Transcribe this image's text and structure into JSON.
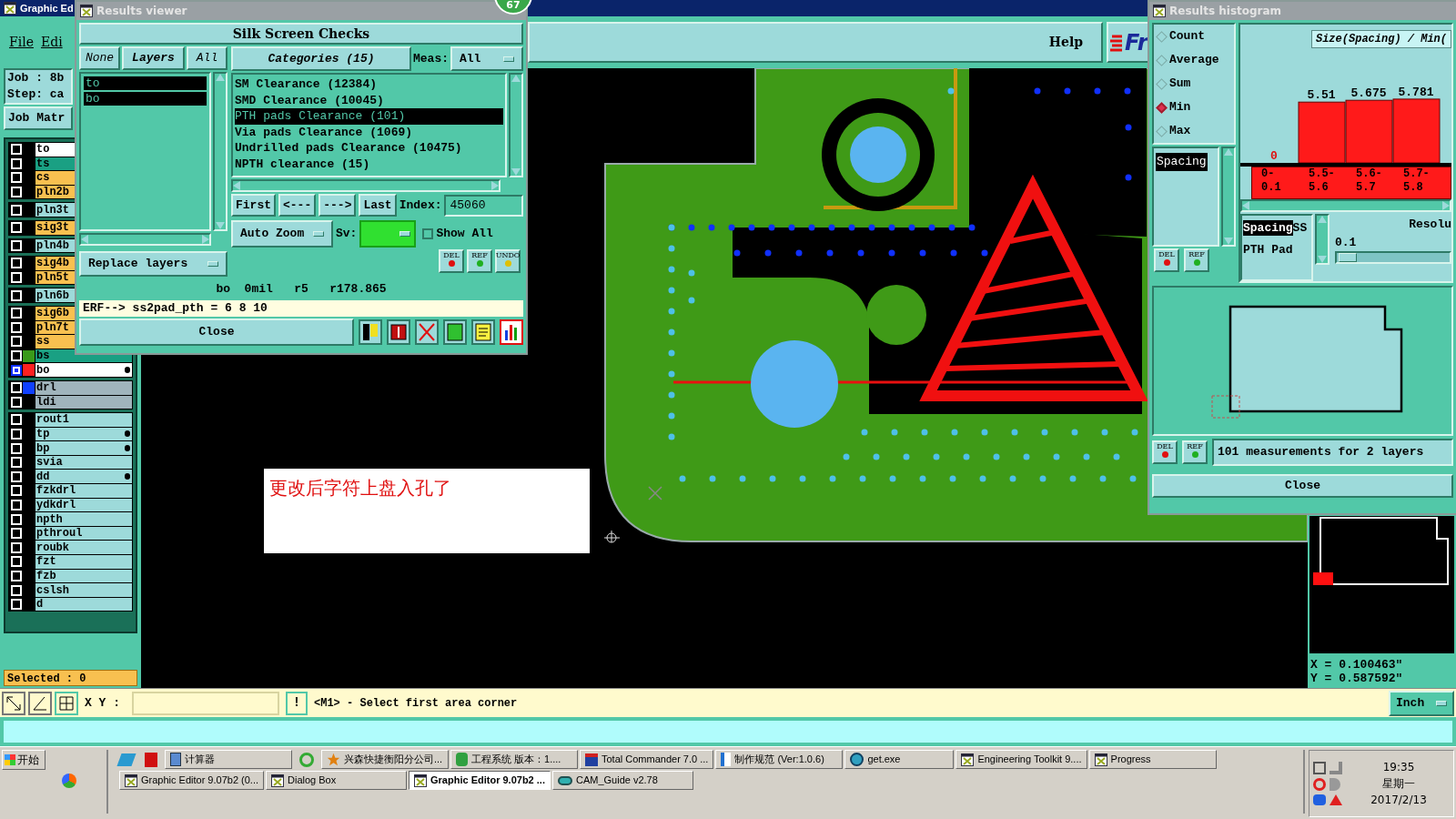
{
  "main_window": {
    "title": "Graphic Ed",
    "menu": [
      "File",
      "Edi"
    ],
    "help": "Help",
    "logo": "Fr"
  },
  "job_info": {
    "job": "Job : 8b",
    "step": "Step: ca",
    "matrix_button": "Job Matr"
  },
  "layer_groups": [
    {
      "layers": [
        {
          "name": "to",
          "color": "#ffffff",
          "selected": false
        },
        {
          "name": "ts",
          "color": "#1aa083",
          "selected": false
        },
        {
          "name": "cs",
          "color": "#f8c050",
          "selected": false
        },
        {
          "name": "pln2b",
          "color": "#f8c050",
          "selected": false
        }
      ]
    },
    {
      "layers": [
        {
          "name": "pln3t",
          "color": "#9ddada",
          "selected": false
        }
      ]
    },
    {
      "layers": [
        {
          "name": "sig3t",
          "color": "#f8c050",
          "selected": false
        }
      ]
    },
    {
      "layers": [
        {
          "name": "pln4b",
          "color": "#9ddada",
          "selected": false
        }
      ]
    },
    {
      "layers": [
        {
          "name": "sig4b",
          "color": "#f8c050",
          "selected": false
        },
        {
          "name": "pln5t",
          "color": "#f8c050",
          "selected": false
        }
      ]
    },
    {
      "layers": [
        {
          "name": "pln6b",
          "color": "#9ddada",
          "selected": false
        }
      ]
    },
    {
      "layers": [
        {
          "name": "sig6b",
          "color": "#f8c050",
          "selected": false
        },
        {
          "name": "pln7t",
          "color": "#f8c050",
          "selected": false
        },
        {
          "name": "ss",
          "color": "#f8c050",
          "selected": false
        },
        {
          "name": "bs",
          "color": "#1aa083",
          "swatch": {
            "color": "#3a9a1a"
          },
          "selected": false,
          "marked": false
        },
        {
          "name": "bo",
          "color": "#ffffff",
          "swatch": {
            "color": "#ff2020"
          },
          "selected": true,
          "marked": true
        }
      ]
    },
    {
      "layers": [
        {
          "name": "drl",
          "color": "#a0b4bc",
          "swatch": {
            "color": "#1040ff"
          },
          "selected": false,
          "marked": false
        },
        {
          "name": "ldi",
          "color": "#a0b4bc",
          "selected": false,
          "marked": false
        }
      ]
    },
    {
      "layers": [
        {
          "name": "rout1",
          "color": "#9ddada",
          "selected": false,
          "marked": false
        },
        {
          "name": "tp",
          "color": "#9ddada",
          "selected": false,
          "marked": true
        },
        {
          "name": "bp",
          "color": "#9ddada",
          "selected": false,
          "marked": true
        },
        {
          "name": "svia",
          "color": "#9ddada",
          "selected": false,
          "marked": false
        },
        {
          "name": "dd",
          "color": "#9ddada",
          "selected": false,
          "marked": true
        },
        {
          "name": "fzkdrl",
          "color": "#9ddada",
          "selected": false,
          "marked": false
        },
        {
          "name": "ydkdrl",
          "color": "#9ddada",
          "selected": false,
          "marked": false
        },
        {
          "name": "npth",
          "color": "#9ddada",
          "selected": false,
          "marked": false
        },
        {
          "name": "pthroul",
          "color": "#9ddada",
          "selected": false,
          "marked": false
        },
        {
          "name": "roubk",
          "color": "#9ddada",
          "selected": false,
          "marked": false
        },
        {
          "name": "fzt",
          "color": "#9ddada",
          "selected": false,
          "marked": false
        },
        {
          "name": "fzb",
          "color": "#9ddada",
          "selected": false,
          "marked": false
        },
        {
          "name": "cslsh",
          "color": "#9ddada",
          "selected": false,
          "marked": false
        },
        {
          "name": "d",
          "color": "#9ddada",
          "selected": false,
          "marked": false
        }
      ]
    }
  ],
  "selected_count": "Selected : 0",
  "note": "更改后字符上盘入孔了",
  "badge": "67",
  "results_viewer": {
    "title": "Results viewer",
    "header": "Silk Screen Checks",
    "layer_buttons": [
      "None",
      "Layers",
      "All"
    ],
    "layers": [
      {
        "name": "to",
        "selected": true
      },
      {
        "name": "bo",
        "selected": true
      }
    ],
    "replace": "Replace layers",
    "categories_button": "Categories (15)",
    "meas_label": "Meas:",
    "meas_value": "All",
    "categories": [
      {
        "label": "SM Clearance (12384)",
        "selected": false
      },
      {
        "label": "SMD Clearance (10045)",
        "selected": false
      },
      {
        "label": "PTH pads Clearance (101)",
        "selected": true
      },
      {
        "label": "Via pads Clearance (1069)",
        "selected": false
      },
      {
        "label": "Undrilled pads Clearance (10475)",
        "selected": false
      },
      {
        "label": "NPTH clearance (15)",
        "selected": false
      }
    ],
    "nav": [
      "First",
      "<---",
      "--->",
      "Last"
    ],
    "index_label": "Index:",
    "index_value": "45060",
    "zoom": "Auto Zoom",
    "sv_label": "Sv:",
    "show_all": {
      "label": "Show All",
      "checked": false
    },
    "tool_buttons": [
      "DEL",
      "REF",
      "UNDO"
    ],
    "status": "bo  0mil   r5   r178.865",
    "erf": "ERF--> ss2pad_pth = 6 8 10",
    "close": "Close"
  },
  "histogram": {
    "title": "Results histogram",
    "modes": [
      {
        "label": "Count",
        "selected": false
      },
      {
        "label": "Average",
        "selected": false
      },
      {
        "label": "Sum",
        "selected": false
      },
      {
        "label": "Min",
        "selected": true
      },
      {
        "label": "Max",
        "selected": false
      }
    ],
    "list": [
      {
        "label": "Spacing",
        "selected": true
      }
    ],
    "buttons": [
      "DEL",
      "REF"
    ],
    "bottom_buttons": [
      "DEL",
      "REF"
    ],
    "chart_data": {
      "type": "bar",
      "title": "Size(Spacing) / Min(",
      "categories": [
        "0-0.1",
        "5.5-5.6",
        "5.6-5.7",
        "5.7-5.8"
      ],
      "values": [
        0,
        5.51,
        5.675,
        5.781
      ],
      "data_labels": true
    },
    "measures": [
      {
        "label": "Spacing",
        "selected": true
      },
      {
        "label": "SS",
        "selected": false
      },
      {
        "label": "PTH Pad",
        "selected": false
      }
    ],
    "resolution": {
      "label": "Resolu",
      "value": "0.1",
      "level": 0.1
    },
    "summary": "101 measurements for 2 layers",
    "close": "Close"
  },
  "coordinates": {
    "x": "X = 0.100463\"",
    "y": "Y = 0.587592\""
  },
  "command_bar": {
    "label": "X Y :",
    "alert": "!",
    "message": "<M1> - Select first area corner",
    "unit": "Inch"
  },
  "taskbar": {
    "start": "开始",
    "row1": [
      {
        "label": "计算器",
        "kind": "calc",
        "selected": false
      },
      {
        "label": "兴森快捷衡阳分公司...",
        "kind": "star",
        "selected": false
      },
      {
        "label": "工程系统  版本：1....",
        "kind": "p",
        "selected": false
      },
      {
        "label": "Total Commander 7.0 ...",
        "kind": "disk",
        "selected": false
      },
      {
        "label": "制作规范 (Ver:1.0.6)",
        "kind": "doc",
        "selected": false
      },
      {
        "label": "get.exe",
        "kind": "exe",
        "selected": false
      },
      {
        "label": "Engineering Toolkit 9....",
        "kind": "xwin",
        "selected": false
      },
      {
        "label": "Progress",
        "kind": "xwin",
        "selected": false
      }
    ],
    "row2": [
      {
        "label": "Graphic Editor 9.07b2 (0...",
        "kind": "xwin",
        "selected": false
      },
      {
        "label": "Dialog Box",
        "kind": "xwin",
        "selected": false
      },
      {
        "label": "Graphic Editor 9.07b2 ...",
        "kind": "xwin",
        "selected": true
      },
      {
        "label": "CAM_Guide v2.78",
        "kind": "eye",
        "selected": false
      }
    ],
    "time": "19:35",
    "day": "星期一",
    "date": "2017/2/13"
  }
}
